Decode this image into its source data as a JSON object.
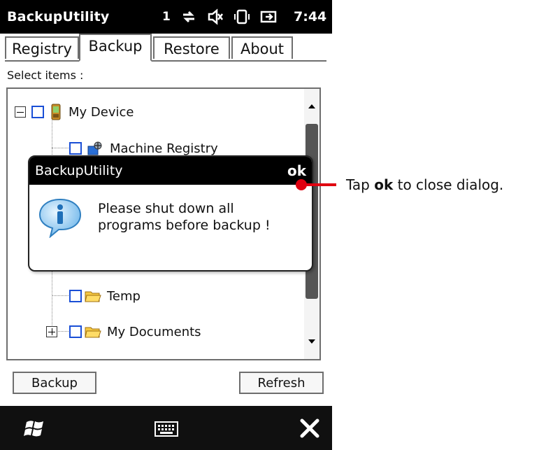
{
  "window": {
    "title": "BackupUtility"
  },
  "status": {
    "signal": "1",
    "time": "7:44"
  },
  "tabs": [
    {
      "label": "Registry"
    },
    {
      "label": "Backup"
    },
    {
      "label": "Restore"
    },
    {
      "label": "About"
    }
  ],
  "main": {
    "select_label": "Select items :",
    "tree": [
      {
        "label": "My Device"
      },
      {
        "label": "Machine Registry"
      },
      {
        "label": "Temp"
      },
      {
        "label": "My Documents"
      }
    ]
  },
  "buttons": {
    "backup": "Backup",
    "refresh": "Refresh"
  },
  "dialog": {
    "title": "BackupUtility",
    "ok": "ok",
    "message_line1": "Please shut down all",
    "message_line2": "programs before backup !"
  },
  "callout": {
    "prefix": "Tap ",
    "bold": "ok",
    "suffix": " to close dialog."
  },
  "colors": {
    "checkbox_border": "#1a4fd6",
    "callout_red": "#e00010",
    "title_bar": "#000000"
  },
  "icons": [
    "start-icon",
    "keyboard-icon",
    "close-icon",
    "info-icon",
    "folder-icon",
    "device-icon",
    "registry-icon"
  ]
}
